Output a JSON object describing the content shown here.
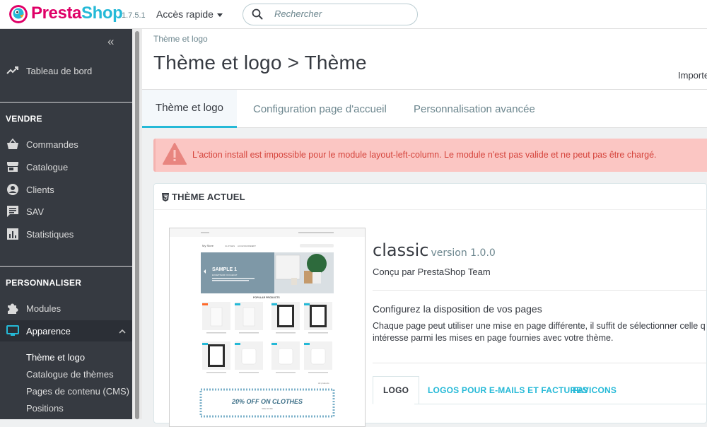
{
  "header": {
    "brand_prefix": "Presta",
    "brand_suffix": "Shop",
    "version": "1.7.5.1",
    "quick_access": "Accès rapide",
    "search_placeholder": "Rechercher"
  },
  "sidebar": {
    "collapse": "«",
    "dashboard": "Tableau de bord",
    "section_sell": "VENDRE",
    "sell_items": [
      "Commandes",
      "Catalogue",
      "Clients",
      "SAV",
      "Statistiques"
    ],
    "section_customize": "PERSONNALISER",
    "customize_items": [
      "Modules",
      "Apparence"
    ],
    "sub_items": [
      "Thème et logo",
      "Catalogue de thèmes",
      "Pages de contenu (CMS)",
      "Positions"
    ]
  },
  "page": {
    "breadcrumb": "Thème et logo",
    "title": "Thème et logo > Thème",
    "toolbar_import": "Importe",
    "tabs": [
      "Thème et logo",
      "Configuration page d'accueil",
      "Personnalisation avancée"
    ],
    "alert": "L'action install est impossible pour le module layout-left-column. Le module n'est pas valide et ne peut pas être chargé."
  },
  "panel": {
    "title": "THÈME ACTUEL",
    "theme_name": "classic",
    "theme_version": "version 1.0.0",
    "author": "Conçu par PrestaShop Team",
    "layout_title": "Configurez la disposition de vos pages",
    "layout_desc": "Chaque page peut utiliser une mise en page différente, il suffit de sélectionner celle q\nintéresse parmi les mises en page fournies avec votre thème.",
    "subtabs": [
      "LOGO",
      "LOGOS POUR E-MAILS ET FACTURES",
      "FAVICONS"
    ]
  },
  "preview": {
    "store_name": "My Store",
    "nav": [
      "CLOTHES",
      "ACCESSORIES",
      "ART"
    ],
    "slide_title": "SAMPLE 1",
    "slide_sub": "EXCEPTEUR OCCAECAT",
    "popular": "POPULAR PRODUCTS",
    "banner": "20% OFF ON CLOTHES",
    "banner_sub": "SEE MORE",
    "all_products": "All products"
  },
  "colors": {
    "accent": "#25b9d7",
    "brand_pink": "#df0067",
    "sidebar_bg": "#363a41",
    "alert_bg": "#fbc6c3",
    "alert_text": "#d5443c"
  }
}
